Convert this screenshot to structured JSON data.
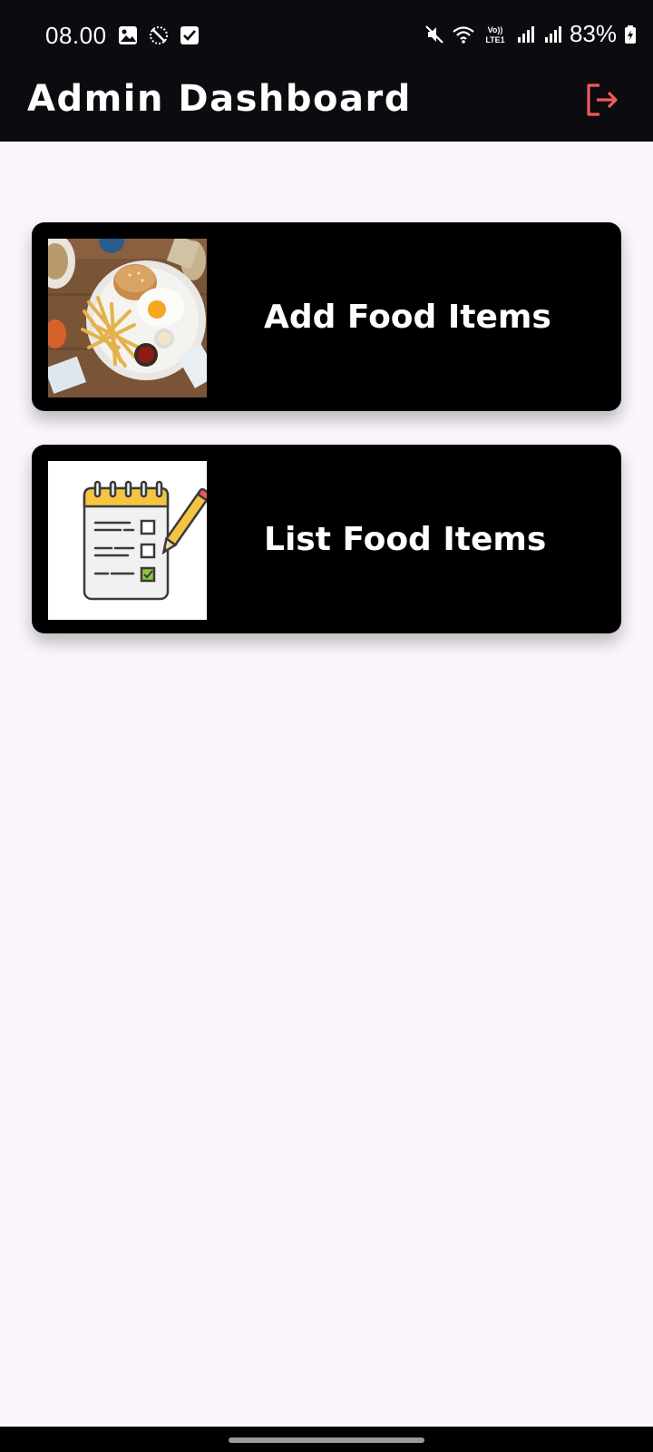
{
  "status_bar": {
    "time": "08.00",
    "battery": "83%",
    "left_icons": [
      "image-icon",
      "do-not-disturb-icon",
      "checkbox-icon"
    ],
    "right_icons": [
      "mute-icon",
      "wifi-icon",
      "volte-lte-icon",
      "signal-icon",
      "signal-icon",
      "battery-charging-icon"
    ],
    "volte_label": "Vo)) LTE1"
  },
  "app_bar": {
    "title": "Admin Dashboard",
    "logout_icon": "logout-icon",
    "logout_color": "#f25a5a"
  },
  "cards": [
    {
      "label": "Add Food Items",
      "image": "food-plate-image"
    },
    {
      "label": "List Food Items",
      "image": "checklist-notepad-image"
    }
  ],
  "colors": {
    "background": "#fbf5fd",
    "app_bar": "#0b0b10",
    "card": "#000000",
    "text": "#ffffff"
  }
}
